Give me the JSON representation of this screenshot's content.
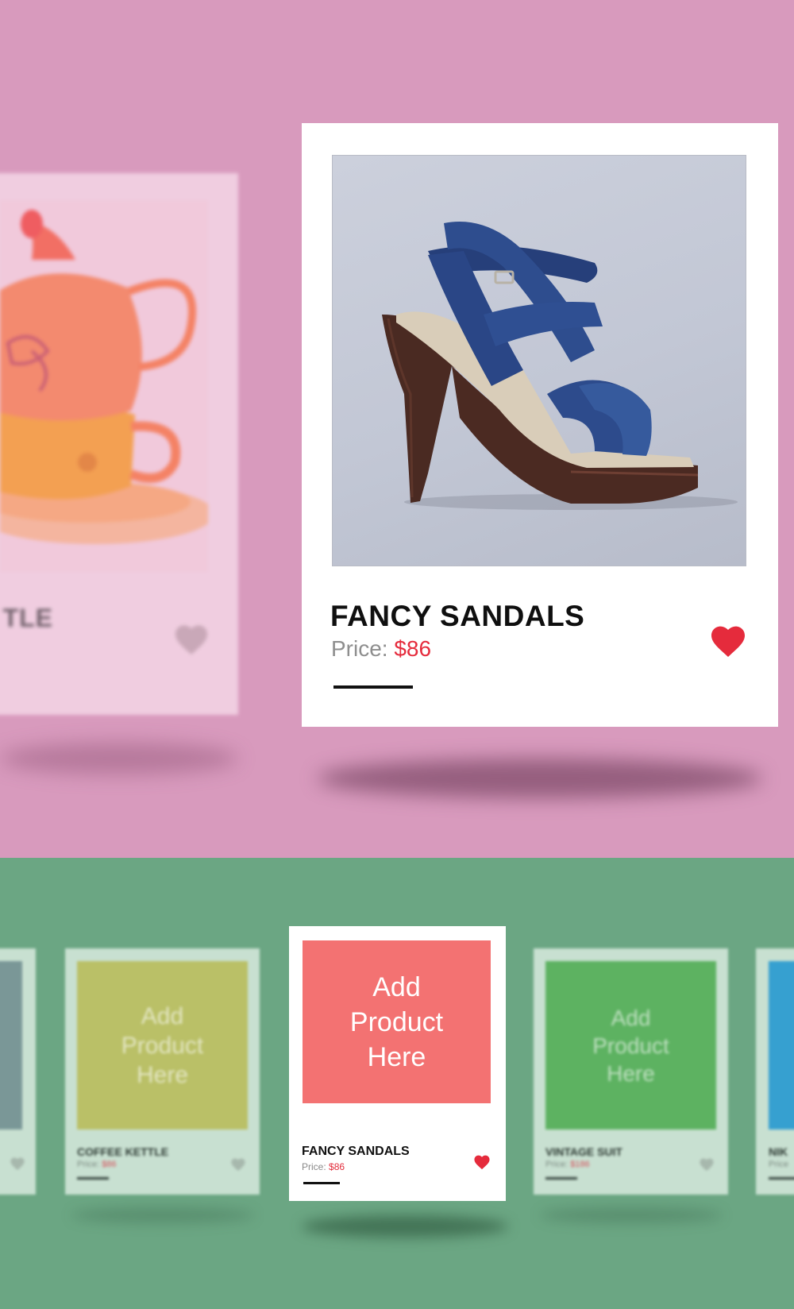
{
  "featured": {
    "title": "FANCY SANDALS",
    "price_label": "Price:",
    "price_value": "$86"
  },
  "background_card": {
    "title_fragment": "TLE"
  },
  "carousel": {
    "focused": {
      "placeholder": "Add\nProduct\nHere",
      "title": "FANCY SANDALS",
      "price_label": "Price:",
      "price_value": "$86"
    },
    "left": {
      "placeholder": "Add\nProduct\nHere",
      "title": "COFFEE KETTLE",
      "price_label": "Price:",
      "price_value": "$86"
    },
    "right": {
      "placeholder": "Add\nProduct\nHere",
      "title": "VINTAGE SUIT",
      "price_label": "Price:",
      "price_value": "$186"
    },
    "far_right": {
      "title": "NIK",
      "price_label": "Price"
    }
  },
  "colors": {
    "top_background": "#d89abd",
    "bottom_background": "#6ba683",
    "accent_red": "#e52b3c",
    "placeholder_coral": "#f37272",
    "placeholder_olive": "#bac067",
    "placeholder_green": "#5db261",
    "placeholder_blue": "#36a0d0",
    "placeholder_slate": "#7a9797"
  },
  "icons": {
    "favorite": "heart-icon"
  }
}
